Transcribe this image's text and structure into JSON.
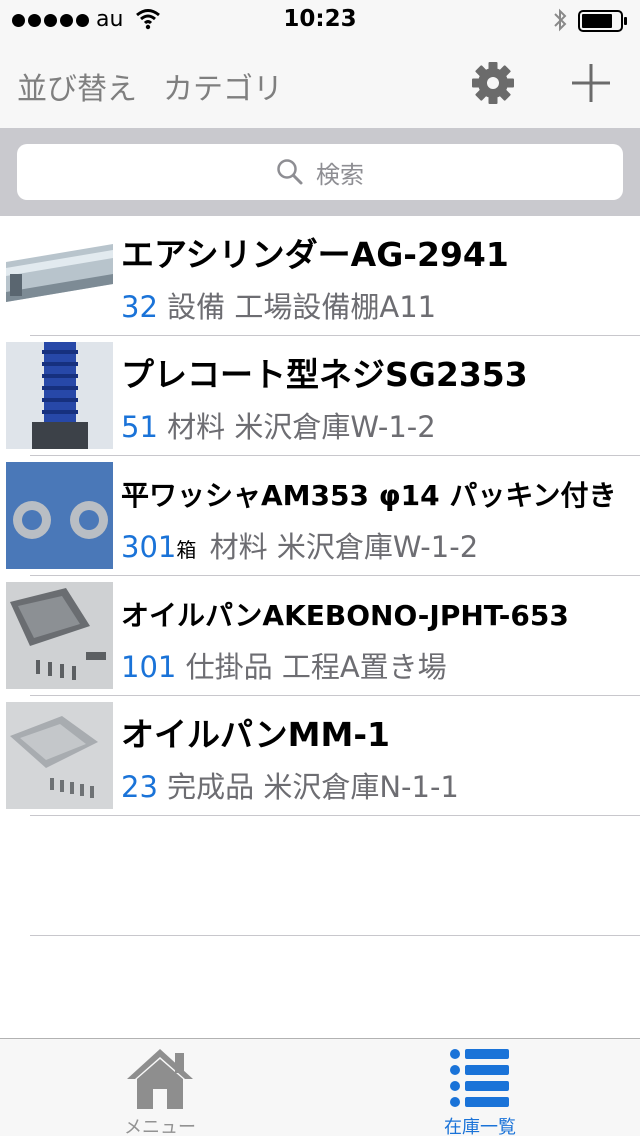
{
  "status_bar": {
    "carrier": "au",
    "time": "10:23"
  },
  "nav": {
    "sort_label": "並び替え",
    "category_label": "カテゴリ",
    "settings_icon": "gear-icon",
    "add_icon": "plus-icon"
  },
  "search": {
    "placeholder": "検索"
  },
  "items": [
    {
      "name": "エアシリンダーAG-2941",
      "quantity": "32",
      "unit": "",
      "category": "設備",
      "location": "工場設備棚A11"
    },
    {
      "name": "プレコート型ネジSG2353",
      "quantity": "51",
      "unit": "",
      "category": "材料",
      "location": "米沢倉庫W-1-2"
    },
    {
      "name": "平ワッシャAM353 φ14 パッキン付き",
      "quantity": "301",
      "unit": "箱",
      "category": "材料",
      "location": "米沢倉庫W-1-2"
    },
    {
      "name": "オイルパンAKEBONO-JPHT-653",
      "quantity": "101",
      "unit": "",
      "category": "仕掛品",
      "location": "工程A置き場"
    },
    {
      "name": "オイルパンMM-1",
      "quantity": "23",
      "unit": "",
      "category": "完成品",
      "location": "米沢倉庫N-1-1"
    }
  ],
  "tabs": [
    {
      "label": "メニュー",
      "icon": "home-icon",
      "selected": false
    },
    {
      "label": "在庫一覧",
      "icon": "list-icon",
      "selected": true
    }
  ],
  "colors": {
    "accent": "#1a73d8",
    "nav_text": "#7f7f7f",
    "search_bg": "#c9c9ce"
  }
}
